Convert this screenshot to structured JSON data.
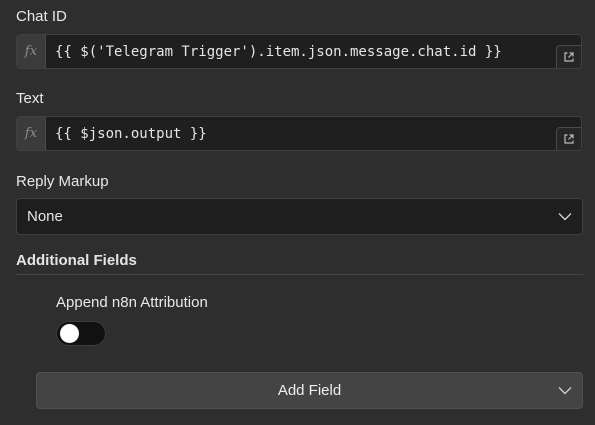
{
  "chat_id": {
    "label": "Chat ID",
    "fx_glyph": "fx",
    "value": "{{ $('Telegram Trigger').item.json.message.chat.id }}"
  },
  "text": {
    "label": "Text",
    "fx_glyph": "fx",
    "value": "{{ $json.output }}"
  },
  "reply_markup": {
    "label": "Reply Markup",
    "value": "None"
  },
  "additional_fields": {
    "title": "Additional Fields",
    "append_attribution": {
      "label": "Append n8n Attribution",
      "enabled": false
    },
    "add_field_label": "Add Field"
  },
  "icons": {
    "expand": "external-expand-icon",
    "dropdown": "chevron-down-icon"
  }
}
